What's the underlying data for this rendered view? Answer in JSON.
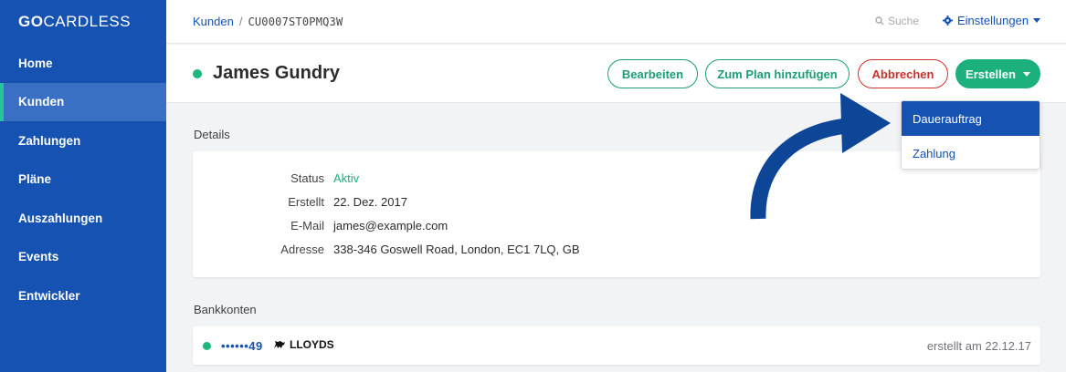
{
  "brand": {
    "bold": "GO",
    "rest": "CARDLESS"
  },
  "nav": [
    {
      "label": "Home"
    },
    {
      "label": "Kunden"
    },
    {
      "label": "Zahlungen"
    },
    {
      "label": "Pläne"
    },
    {
      "label": "Auszahlungen"
    },
    {
      "label": "Events"
    },
    {
      "label": "Entwickler"
    }
  ],
  "breadcrumb": {
    "parent": "Kunden",
    "separator": "/",
    "current": "CU0007ST0PMQ3W"
  },
  "search": {
    "placeholder": "Suche",
    "icon": "search-icon"
  },
  "settings": {
    "label": "Einstellungen",
    "icon": "gear-icon"
  },
  "customer": {
    "name": "James Gundry",
    "status_color": "#1cb77f"
  },
  "actions": {
    "edit": "Bearbeiten",
    "add_to_plan": "Zum Plan hinzufügen",
    "cancel": "Abbrechen",
    "create": "Erstellen"
  },
  "create_menu": [
    {
      "label": "Dauerauftrag",
      "selected": true
    },
    {
      "label": "Zahlung",
      "selected": false
    }
  ],
  "details": {
    "title": "Details",
    "rows": [
      {
        "label": "Status",
        "value": "Aktiv"
      },
      {
        "label": "Erstellt",
        "value": "22. Dez. 2017"
      },
      {
        "label": "E-Mail",
        "value": "james@example.com"
      },
      {
        "label": "Adresse",
        "value": "338-346 Goswell Road, London, EC1 7LQ, GB"
      }
    ]
  },
  "bank_accounts": {
    "title": "Bankkonten",
    "items": [
      {
        "mask": "••••••49",
        "bank": "LLOYDS",
        "created": "erstellt am 22.12.17"
      }
    ]
  },
  "colors": {
    "sidebar": "#1552b2",
    "accent_green": "#1cb07c",
    "danger": "#c9322c",
    "arrow": "#0d4597"
  }
}
